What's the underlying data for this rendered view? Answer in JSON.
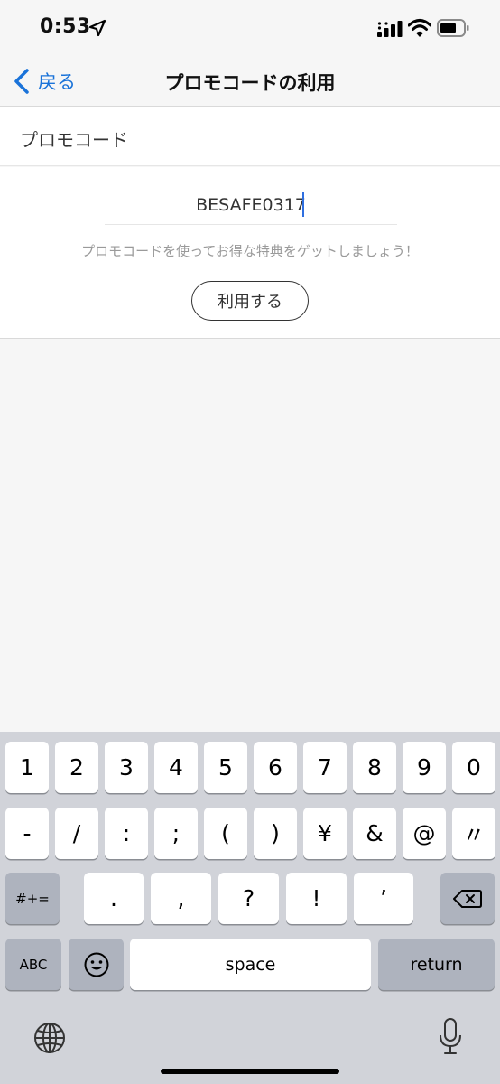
{
  "status": {
    "time": "0:53"
  },
  "nav": {
    "back_label": "戻る",
    "title": "プロモコードの利用"
  },
  "section": {
    "title": "プロモコード"
  },
  "promo": {
    "value": "BESAFE0317",
    "hint": "プロモコードを使ってお得な特典をゲットしましょう！",
    "apply_label": "利用する"
  },
  "keyboard": {
    "row1": [
      "1",
      "2",
      "3",
      "4",
      "5",
      "6",
      "7",
      "8",
      "9",
      "0"
    ],
    "row2": [
      "-",
      "/",
      ":",
      ";",
      "(",
      ")",
      "¥",
      "&",
      "@",
      "〃"
    ],
    "row3_left": "#+=",
    "row3": [
      ".",
      ",",
      "?",
      "!",
      "’"
    ],
    "abc": "ABC",
    "space": "space",
    "return": "return"
  }
}
